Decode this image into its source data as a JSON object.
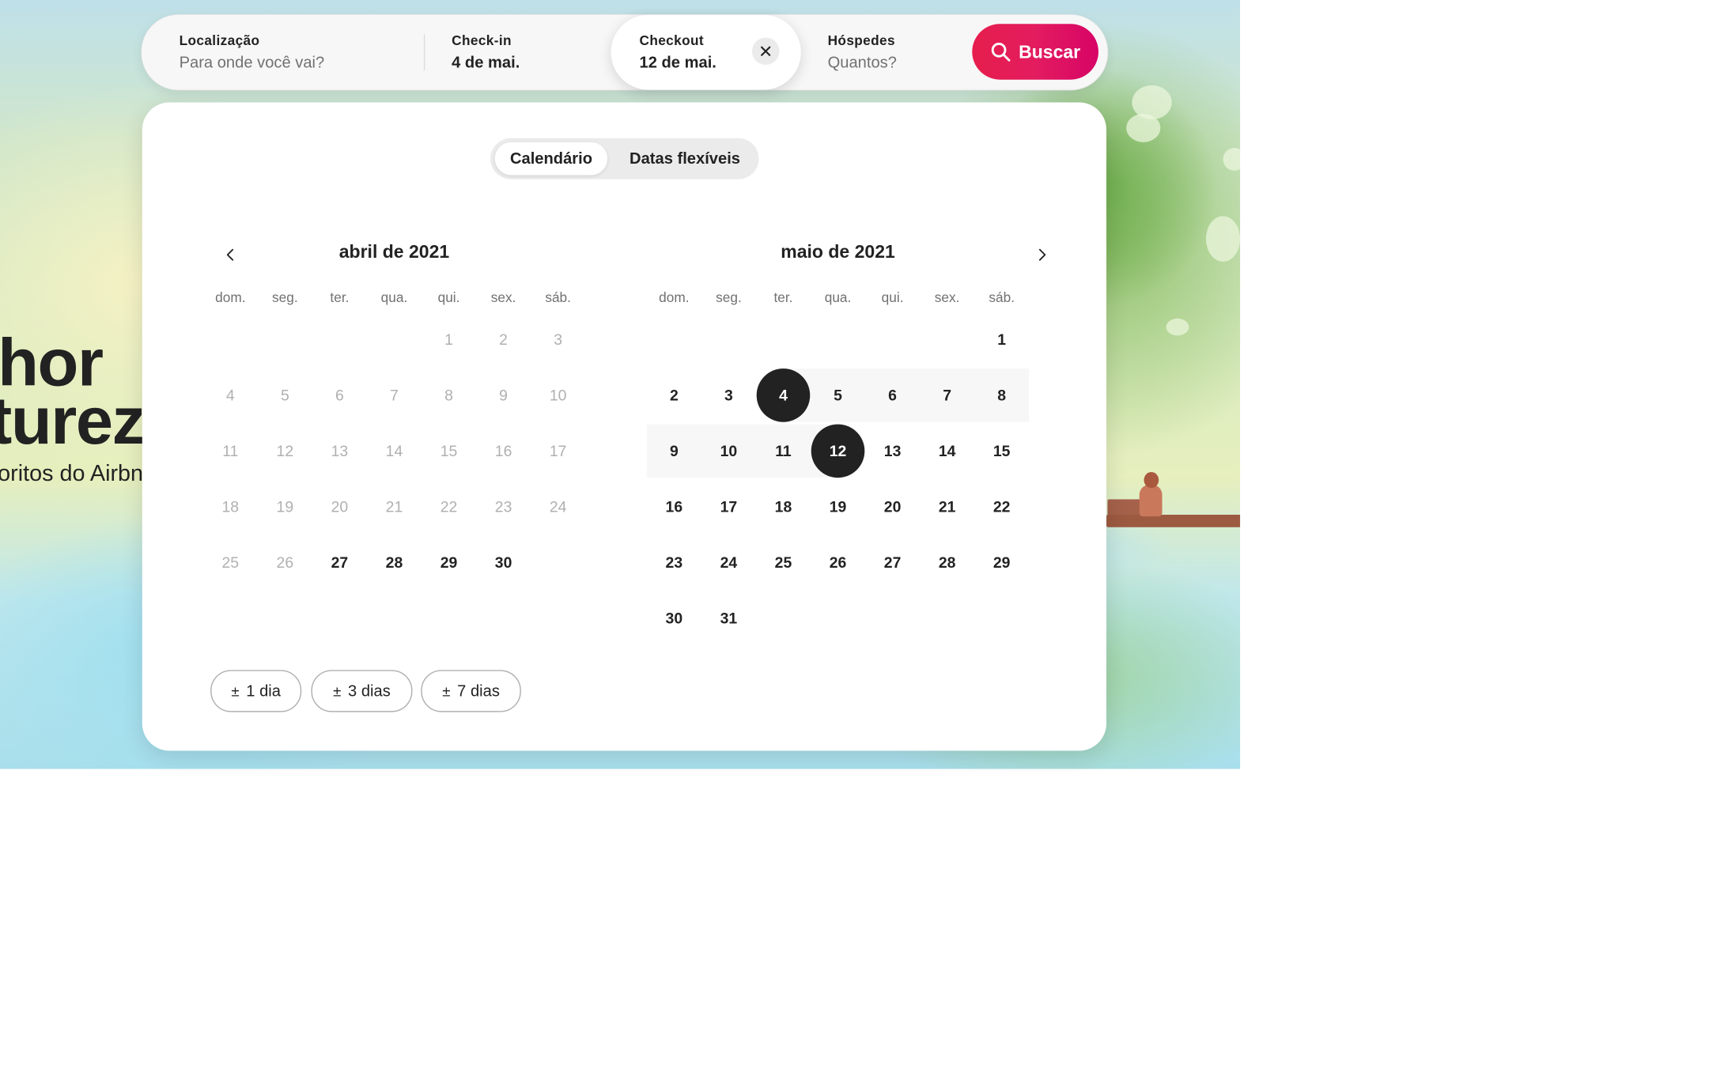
{
  "hero": {
    "line1": "hor",
    "line2": "turez",
    "subtitle": "oritos do Airbn"
  },
  "search": {
    "location": {
      "label": "Localização",
      "placeholder": "Para onde você vai?"
    },
    "checkin": {
      "label": "Check-in",
      "value": "4 de mai."
    },
    "checkout": {
      "label": "Checkout",
      "value": "12 de mai."
    },
    "guests": {
      "label": "Hóspedes",
      "placeholder": "Quantos?"
    },
    "button_label": "Buscar",
    "accent_color": "#e31c5f"
  },
  "calendar": {
    "tabs": [
      "Calendário",
      "Datas flexíveis"
    ],
    "active_tab": "Calendário",
    "weekdays": [
      "dom.",
      "seg.",
      "ter.",
      "qua.",
      "qui.",
      "sex.",
      "sáb."
    ],
    "months": [
      {
        "title": "abril de 2021",
        "first_weekday": 4,
        "days": 30,
        "first_available_day": 27
      },
      {
        "title": "maio de 2021",
        "first_weekday": 6,
        "days": 31,
        "first_available_day": 1
      }
    ],
    "selected_start": {
      "month": 1,
      "day": 4
    },
    "selected_end": {
      "month": 1,
      "day": 12
    },
    "flex_options": [
      "1 dia",
      "3 dias",
      "7 dias"
    ],
    "flex_symbol": "±"
  }
}
